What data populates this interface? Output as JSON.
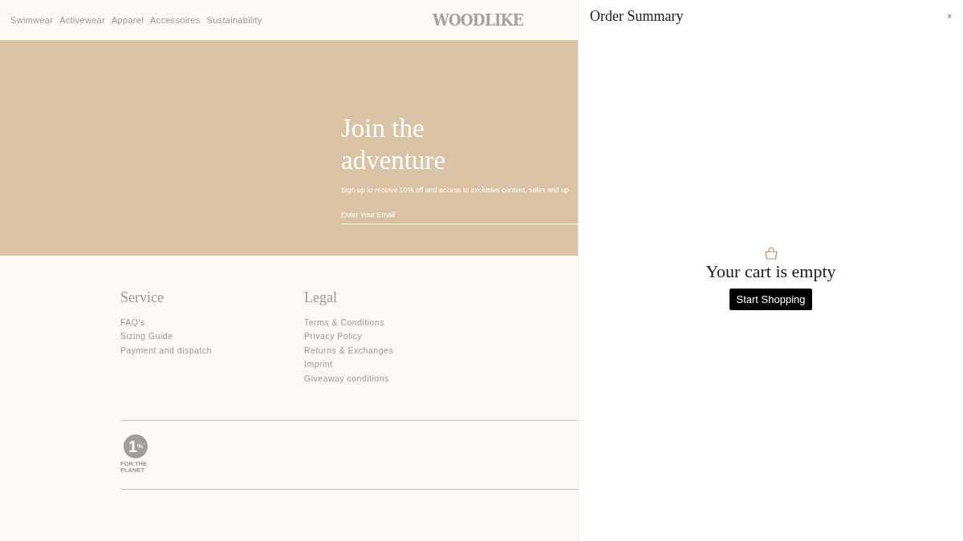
{
  "header": {
    "nav": [
      "Swimwear",
      "Activewear",
      "Apparel",
      "Accessoires",
      "Sustainability"
    ],
    "logo": "WOODLIKE"
  },
  "newsletter": {
    "title": "Join the adventure",
    "subtitle": "Sign up to receive 10% off and access to exclusive content, sales and up",
    "email": {
      "placeholder": "Enter Your Email"
    }
  },
  "footer": {
    "columns": [
      {
        "heading": "Service",
        "links": [
          "FAQ's",
          "Sizing Guide",
          "Payment and dispatch"
        ]
      },
      {
        "heading": "Legal",
        "links": [
          "Terms & Conditions",
          "Privacy Policy",
          "Returns & Exchanges",
          "Imprint",
          "Giveaway conditions"
        ]
      }
    ],
    "badge": {
      "mark": "1$^{%}$",
      "text": "FOR THE PLANET"
    }
  },
  "cart": {
    "title": "Order Summary",
    "close": "×",
    "message": "Your cart is empty",
    "button": "Start Shopping"
  }
}
